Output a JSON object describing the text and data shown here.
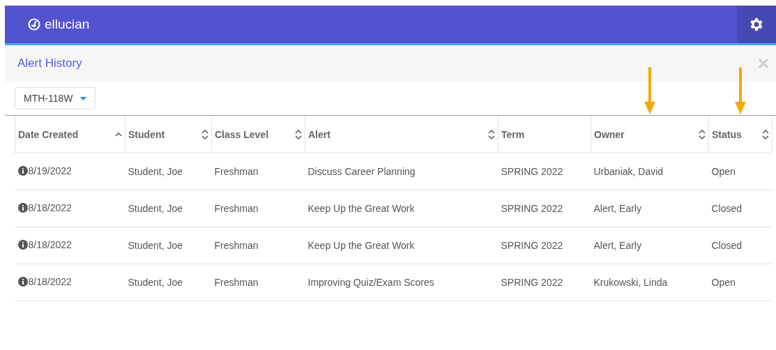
{
  "header": {
    "logo": "ellucian"
  },
  "panel": {
    "title": "Alert History"
  },
  "filter": {
    "value": "MTH-118W"
  },
  "table": {
    "columns": [
      {
        "label": "Date Created",
        "sorted": true,
        "annotated": false
      },
      {
        "label": "Student",
        "sortable": true,
        "sorted": false,
        "annotated": false
      },
      {
        "label": "Class Level",
        "sortable": true,
        "sorted": false,
        "annotated": false
      },
      {
        "label": "Alert",
        "sortable": true,
        "sorted": false,
        "annotated": false
      },
      {
        "label": "Term",
        "sortable": false,
        "sorted": false,
        "annotated": false
      },
      {
        "label": "Owner",
        "sortable": true,
        "sorted": false,
        "annotated": true
      },
      {
        "label": "Status",
        "sortable": true,
        "sorted": false,
        "annotated": true
      }
    ],
    "rows": [
      [
        "8/19/2022",
        "Student, Joe",
        "Freshman",
        "Discuss Career Planning",
        "SPRING 2022",
        "Urbaniak, David",
        "Open"
      ],
      [
        "8/18/2022",
        "Student, Joe",
        "Freshman",
        "Keep Up the Great Work",
        "SPRING 2022",
        "Alert, Early",
        "Closed"
      ],
      [
        "8/18/2022",
        "Student, Joe",
        "Freshman",
        "Keep Up the Great Work",
        "SPRING 2022",
        "Alert, Early",
        "Closed"
      ],
      [
        "8/18/2022",
        "Student, Joe",
        "Freshman",
        "Improving Quiz/Exam Scores",
        "SPRING 2022",
        "Krukowski, Linda",
        "Open"
      ]
    ]
  }
}
